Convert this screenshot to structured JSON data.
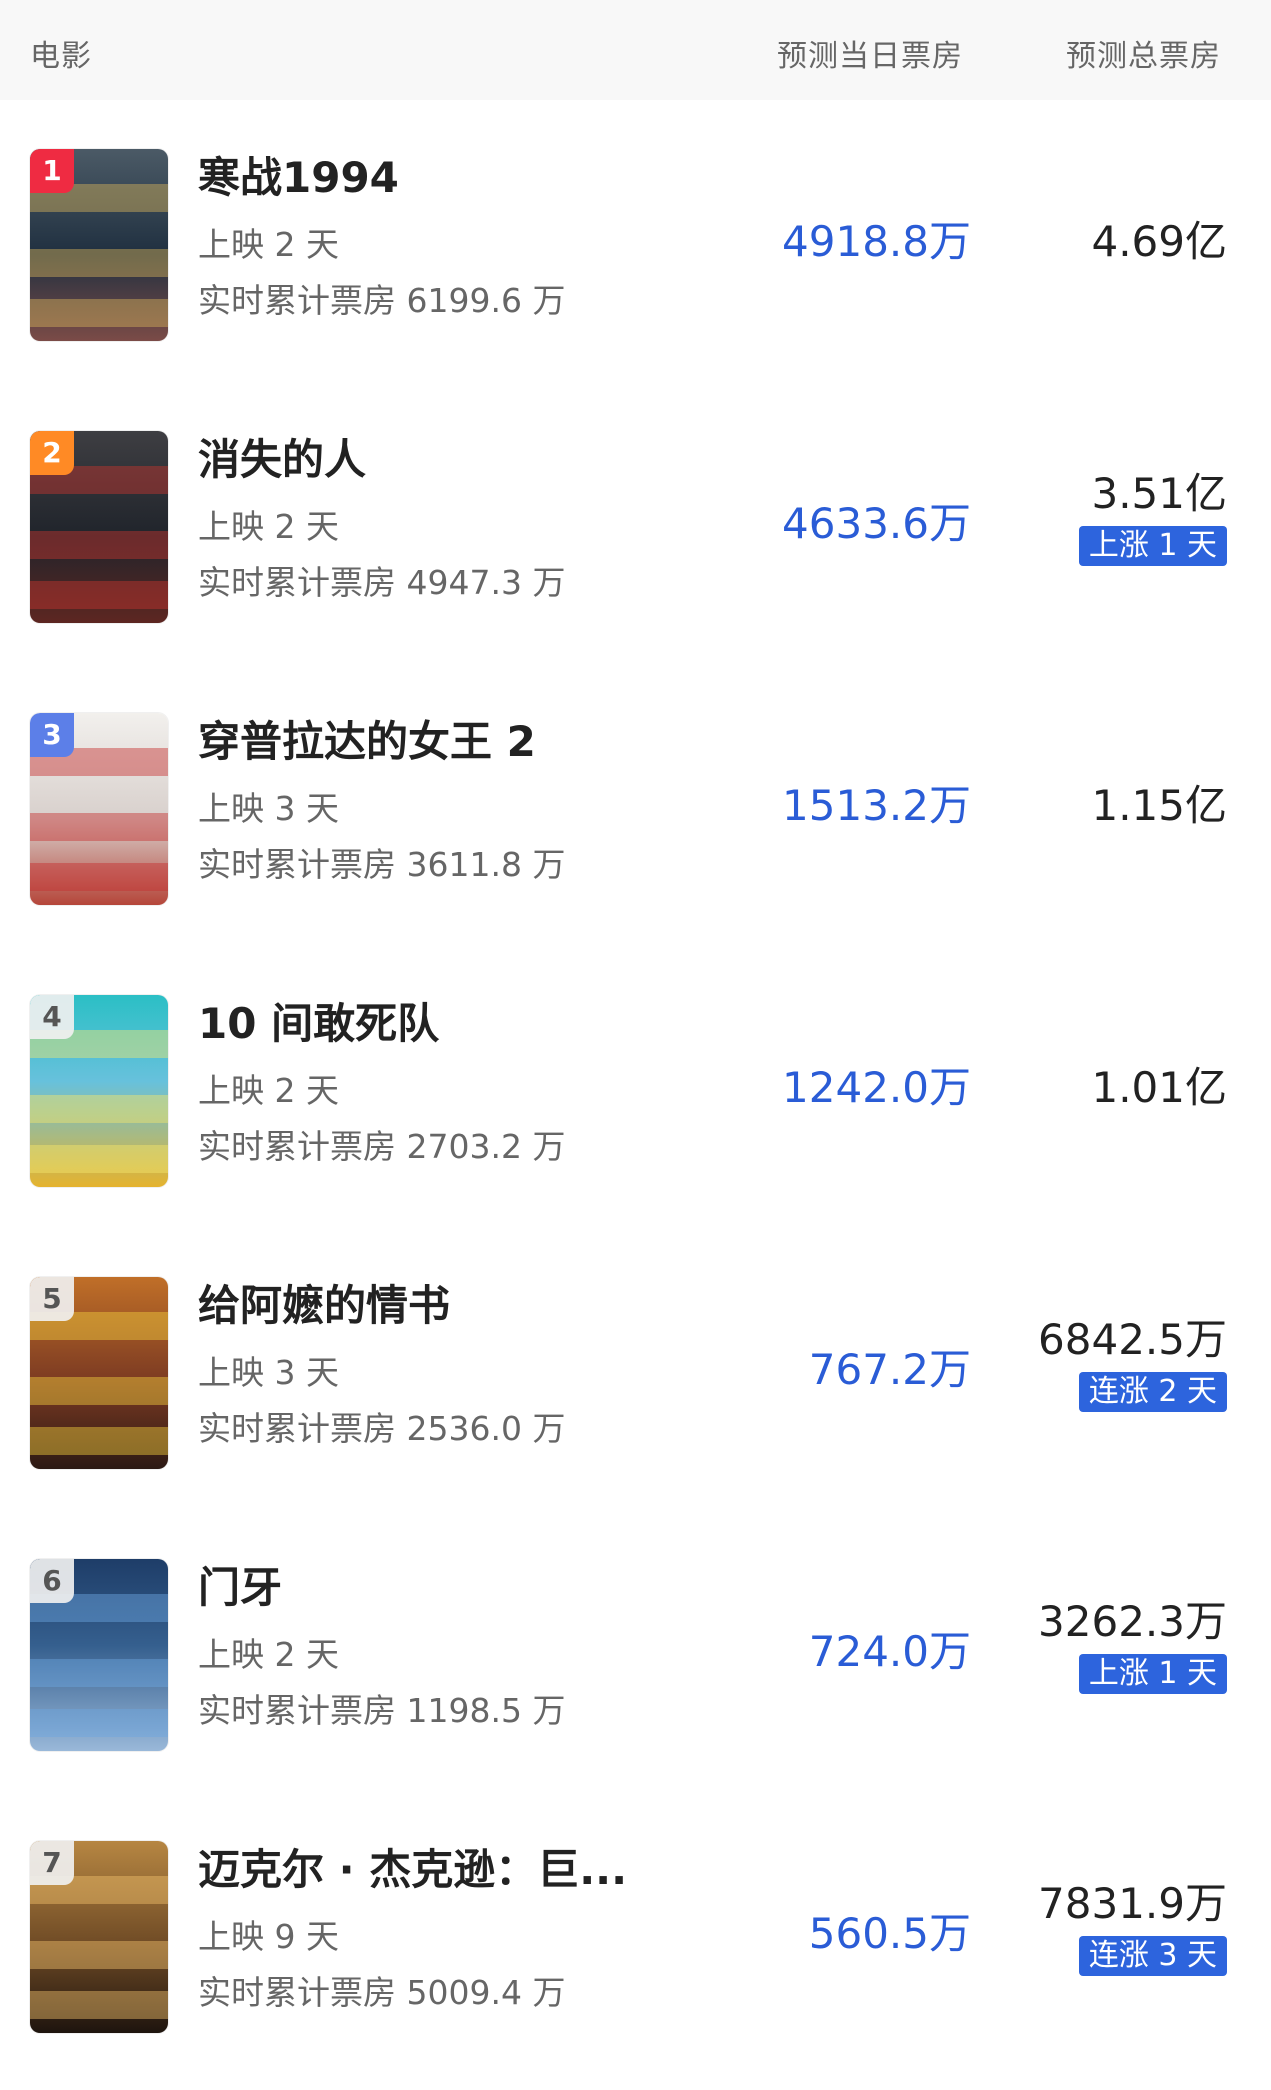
{
  "header": {
    "movie": "电影",
    "today": "预测当日票房",
    "total": "预测总票房"
  },
  "movies": [
    {
      "rank": "1",
      "title": "寒战1994",
      "days": "上映 2 天",
      "cumulative": "实时累计票房 6199.6 万",
      "today": "4918.8万",
      "total": "4.69亿",
      "badge": "",
      "rank_color": "red"
    },
    {
      "rank": "2",
      "title": "消失的人",
      "days": "上映 2 天",
      "cumulative": "实时累计票房 4947.3 万",
      "today": "4633.6万",
      "total": "3.51亿",
      "badge": "上涨 1 天",
      "rank_color": "orange"
    },
    {
      "rank": "3",
      "title": "穿普拉达的女王 2",
      "days": "上映 3 天",
      "cumulative": "实时累计票房 3611.8 万",
      "today": "1513.2万",
      "total": "1.15亿",
      "badge": "",
      "rank_color": "blue"
    },
    {
      "rank": "4",
      "title": "10 间敢死队",
      "days": "上映 2 天",
      "cumulative": "实时累计票房 2703.2 万",
      "today": "1242.0万",
      "total": "1.01亿",
      "badge": "",
      "rank_color": "gray"
    },
    {
      "rank": "5",
      "title": "给阿嬷的情书",
      "days": "上映 3 天",
      "cumulative": "实时累计票房 2536.0 万",
      "today": "767.2万",
      "total": "6842.5万",
      "badge": "连涨 2 天",
      "rank_color": "gray"
    },
    {
      "rank": "6",
      "title": "门牙",
      "days": "上映 2 天",
      "cumulative": "实时累计票房 1198.5 万",
      "today": "724.0万",
      "total": "3262.3万",
      "badge": "上涨 1 天",
      "rank_color": "gray"
    },
    {
      "rank": "7",
      "title": "迈克尔 · 杰克逊：巨...",
      "days": "上映 9 天",
      "cumulative": "实时累计票房 5009.4 万",
      "today": "560.5万",
      "total": "7831.9万",
      "badge": "连涨 3 天",
      "rank_color": "gray"
    }
  ],
  "colors": {
    "today_text": "#2a5cd6",
    "badge_background": "#2d64dd",
    "header_background": "#f8f8f8"
  }
}
